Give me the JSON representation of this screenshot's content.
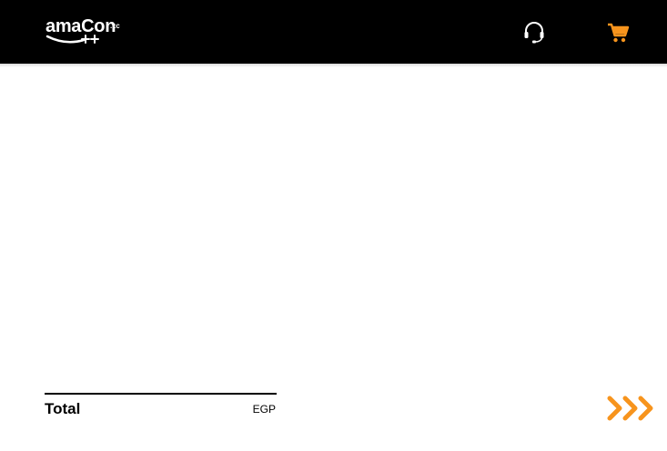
{
  "header": {
    "logo": {
      "name": "amaCon",
      "suffix": ".zc"
    },
    "icons": {
      "support": "headset-icon",
      "cart": "cart-icon"
    },
    "colors": {
      "background": "#000000",
      "accent": "#f7941d"
    }
  },
  "footer": {
    "total_label": "Total",
    "currency": "EGP",
    "proceed_icon": "triple-chevron-right-icon"
  }
}
